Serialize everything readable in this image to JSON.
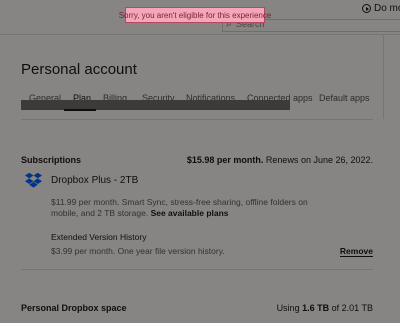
{
  "toast": {
    "message": "Sorry, you aren't eligible for this experience"
  },
  "topbar": {
    "search_placeholder": "Search",
    "do_more_label": "Do mor"
  },
  "page": {
    "title": "Personal account"
  },
  "tabs": [
    {
      "label": "General"
    },
    {
      "label": "Plan"
    },
    {
      "label": "Billing"
    },
    {
      "label": "Security"
    },
    {
      "label": "Notifications"
    },
    {
      "label": "Connected apps"
    },
    {
      "label": "Default apps"
    }
  ],
  "subscriptions": {
    "label": "Subscriptions",
    "price": "$15.98 per month.",
    "renewal": "Renews on June 26, 2022.",
    "plan_name": "Dropbox Plus - 2TB",
    "plan_desc": "$11.99 per month. Smart Sync, stress-free sharing, offline folders on mobile, and 2 TB storage.",
    "plan_link": "See available plans",
    "addon_title": "Extended Version History",
    "addon_desc": "$3.99 per month. One year file version history.",
    "remove_label": "Remove"
  },
  "space": {
    "label": "Personal Dropbox space",
    "usage_prefix": "Using",
    "used": "1.6 TB",
    "usage_suffix": "of 2.01 TB"
  },
  "colors": {
    "toast_bg": "#f4a7b9",
    "toast_border": "#b5485e",
    "dropbox_blue": "#0061fe"
  }
}
